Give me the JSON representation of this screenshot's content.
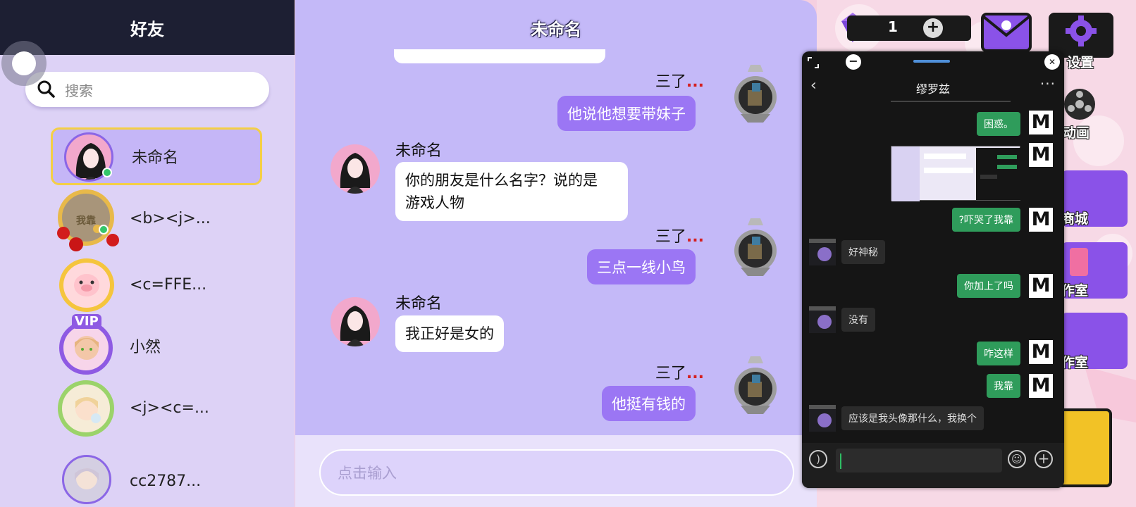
{
  "left_panel": {
    "title": "好友",
    "search_placeholder": "搜索",
    "friends": [
      {
        "name": "未命名"
      },
      {
        "name": "<b><j>...",
        "frame_text": "我靠"
      },
      {
        "name": "<c=FFE..."
      },
      {
        "name": "小然",
        "frame_text": "VIP"
      },
      {
        "name": "<j><c=..."
      },
      {
        "name": "cc2787..."
      }
    ]
  },
  "chat": {
    "title": "未命名",
    "messages": [
      {
        "sender": "三了",
        "ellipsis": "...",
        "text": "他说他想要带妹子"
      },
      {
        "sender": "未命名",
        "text_line1": "你的朋友是什么名字？说的是",
        "text_line2": "游戏人物"
      },
      {
        "sender": "三了",
        "ellipsis": "...",
        "text": "三点一线小鸟"
      },
      {
        "sender": "未命名",
        "text": "我正好是女的"
      },
      {
        "sender": "三了",
        "ellipsis": "...",
        "text": "他挺有钱的"
      }
    ],
    "input_placeholder": "点击输入"
  },
  "hud": {
    "gem_count": "1",
    "gem_plus": "+",
    "settings_label": "设置",
    "anim_label": "动画",
    "shop_label": "商城",
    "studio_label": "作室",
    "studio2_label": "作室"
  },
  "overlay": {
    "title": "缪罗兹",
    "back_glyph": "‹",
    "more_glyph": "···",
    "min_glyph": "−",
    "close_glyph": "✕",
    "m_glyph": "M",
    "messages": [
      {
        "side": "right",
        "text": "困惑。"
      },
      {
        "side": "right",
        "type": "image"
      },
      {
        "side": "right",
        "text": "?吓哭了我靠"
      },
      {
        "side": "left",
        "text": "好神秘"
      },
      {
        "side": "right",
        "text": "你加上了吗"
      },
      {
        "side": "left",
        "text": "没有"
      },
      {
        "side": "right",
        "text": "咋这样"
      },
      {
        "side": "right",
        "text": "我靠"
      },
      {
        "side": "left",
        "text": "应该是我头像那什么，我换个"
      }
    ]
  }
}
